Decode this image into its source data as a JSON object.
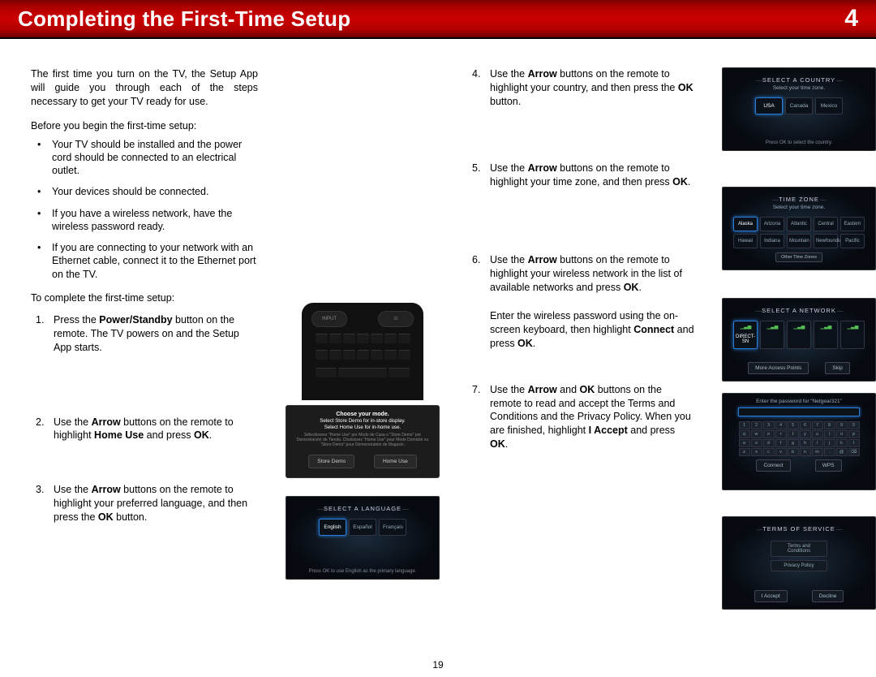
{
  "header": {
    "title": "Completing the First-Time Setup",
    "chapter": "4"
  },
  "intro": "The first time you turn on the TV, the Setup App will guide you through each of the steps necessary to get your TV ready for use.",
  "before_label": "Before you begin the first-time setup:",
  "prechecks": [
    "Your TV should be installed and the power cord should be connected to an electrical outlet.",
    "Your devices should be connected.",
    "If you have a wireless network, have the wireless password ready.",
    "If you are connecting to your network with an Ethernet cable, connect it to the Ethernet port on the TV."
  ],
  "tocomplete": "To complete the first-time setup:",
  "steps_left": {
    "s1_a": "Press the ",
    "s1_b": "Power/Standby",
    "s1_c": " button on the remote. The TV powers on and the Setup App starts.",
    "s2_a": "Use the ",
    "s2_b": "Arrow",
    "s2_c": " buttons on the remote to highlight ",
    "s2_d": "Home Use",
    "s2_e": " and press ",
    "s2_f": "OK",
    "s2_g": ".",
    "s3_a": "Use the ",
    "s3_b": "Arrow",
    "s3_c": " buttons on the remote to highlight your preferred language, and then press the ",
    "s3_d": "OK",
    "s3_e": " button."
  },
  "steps_right": {
    "s4_a": "Use the ",
    "s4_b": "Arrow",
    "s4_c": " buttons on the remote to highlight your country, and then press the ",
    "s4_d": "OK",
    "s4_e": " button.",
    "s5_a": "Use the ",
    "s5_b": "Arrow",
    "s5_c": " buttons on the remote to highlight your time zone, and then press ",
    "s5_d": "OK",
    "s5_e": ".",
    "s6_a": "Use the ",
    "s6_b": "Arrow",
    "s6_c": " buttons on the remote to highlight your wireless network in the list of available networks and press ",
    "s6_d": "OK",
    "s6_e": ".",
    "s6b_a": "Enter the wireless password using the on-screen keyboard, then highlight ",
    "s6b_b": "Connect",
    "s6b_c": " and press ",
    "s6b_d": "OK",
    "s6b_e": ".",
    "s7_a": "Use the ",
    "s7_b": "Arrow",
    "s7_c": " and ",
    "s7_d": "OK",
    "s7_e": " buttons on the remote to read and accept the Terms and Conditions and the Privacy Policy. When you are finished, highlight ",
    "s7_f": "I Accept",
    "s7_g": " and press ",
    "s7_h": "OK",
    "s7_i": "."
  },
  "remote": {
    "input": "INPUT",
    "power_icon": "⏻"
  },
  "mode_dialog": {
    "title": "Choose your mode.",
    "line1": "Select Store Demo for in-store display.",
    "line2": "Select Home Use for in-home use.",
    "fine": "Sélectionnez \"Home Use\" por Modo de Casa o \"Store Demo\" por Demostración de Tienda. Choisissez \"Home Use\" pour Mode Domicile ou \"Store Demo\" pour Démonstration de Magasin.",
    "btn_store": "Store Demo",
    "btn_home": "Home Use"
  },
  "lang_screen": {
    "title": "SELECT A LANGUAGE",
    "opts": [
      "English",
      "Español",
      "Français"
    ],
    "foot": "Press OK to use English as the primary language."
  },
  "country_screen": {
    "title": "SELECT A COUNTRY",
    "sub": "Select your time zone.",
    "opts": [
      "USA",
      "Canada",
      "Mexico"
    ],
    "foot": "Press OK to select the country."
  },
  "tz_screen": {
    "title": "TIME ZONE",
    "sub": "Select your time zone.",
    "row1": [
      "Alaska",
      "Arizona",
      "Atlantic",
      "Central",
      "Eastern"
    ],
    "row2": [
      "Hawaii",
      "Indiana",
      "Mountain",
      "Newfoundland",
      "Pacific"
    ],
    "other": "Other Time Zones"
  },
  "net_screen": {
    "title": "SELECT A NETWORK",
    "opts": [
      "DIRECT-SN",
      "",
      "",
      "",
      ""
    ],
    "btn_more": "More Access Points",
    "btn_skip": "Skip"
  },
  "pw_screen": {
    "title": "Enter the password for \"Netgear321\"",
    "row1": [
      "1",
      "2",
      "3",
      "4",
      "5",
      "6",
      "7",
      "8",
      "9",
      "0"
    ],
    "row2": [
      "q",
      "w",
      "e",
      "r",
      "t",
      "y",
      "u",
      "i",
      "o",
      "p"
    ],
    "row3": [
      "a",
      "s",
      "d",
      "f",
      "g",
      "h",
      "i",
      "j",
      "k",
      "l"
    ],
    "row4": [
      "z",
      "x",
      "c",
      "v",
      "b",
      "n",
      "m",
      ".",
      "@",
      "⌫"
    ],
    "btn_connect": "Connect",
    "btn_wps": "WPS"
  },
  "terms_screen": {
    "title": "TERMS OF SERVICE",
    "items": [
      "Terms and Conditions",
      "Privacy Policy"
    ],
    "btn_accept": "I Accept",
    "btn_decline": "Decline"
  },
  "page_number": "19"
}
